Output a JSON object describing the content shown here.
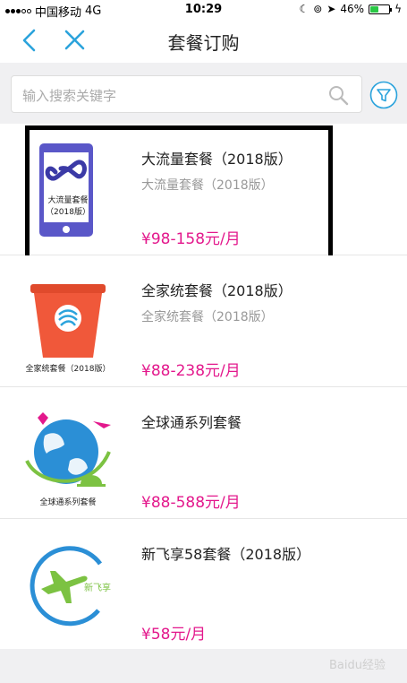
{
  "status_bar": {
    "carrier": "中国移动",
    "network": "4G",
    "time": "10:29",
    "battery": "46%",
    "battery_level": 0.46
  },
  "nav": {
    "title": "套餐订购"
  },
  "search": {
    "placeholder": "输入搜索关键字"
  },
  "packages": [
    {
      "name": "大流量套餐（2018版）",
      "subtitle": "大流量套餐（2018版）",
      "price": "¥98-158元/月",
      "thumb_label_1": "大流量套餐",
      "thumb_label_2": "（2018版）"
    },
    {
      "name": "全家统套餐（2018版）",
      "subtitle": "全家统套餐（2018版）",
      "price": "¥88-238元/月",
      "thumb_label": "全家统套餐（2018版）"
    },
    {
      "name": "全球通系列套餐",
      "subtitle": "",
      "price": "¥88-588元/月",
      "thumb_label": "全球通系列套餐"
    },
    {
      "name": "新飞享58套餐（2018版）",
      "subtitle": "",
      "price": "¥58元/月",
      "thumb_label": "新飞享"
    }
  ],
  "watermark": "Baidu经验",
  "colors": {
    "accent": "#2ba3dc",
    "price": "#e3188c",
    "highlight_border": "#000000"
  }
}
